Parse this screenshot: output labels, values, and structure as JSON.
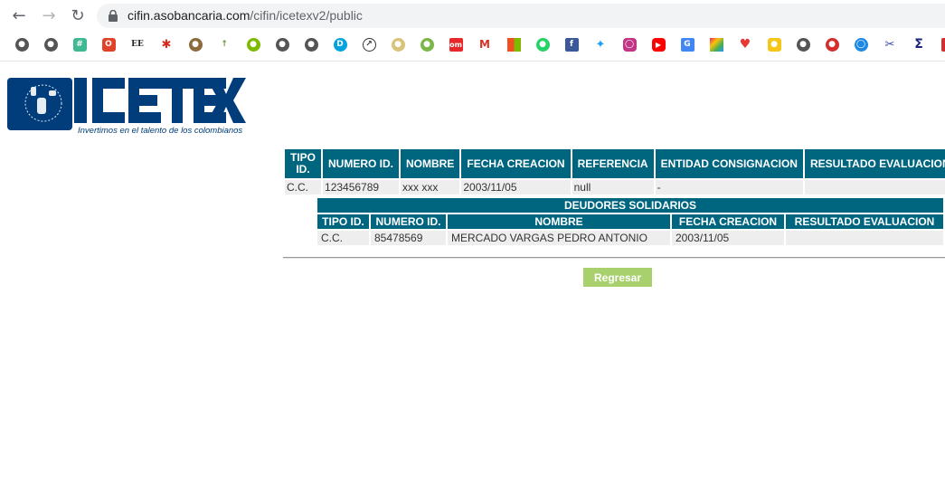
{
  "browser": {
    "url_host": "cifin.asobancaria.com",
    "url_path": "/cifin/icetexv2/public",
    "bookmark_icons": [
      "globe-icon",
      "globe-icon",
      "slack-icon",
      "power-icon",
      "ee-icon",
      "maple-leaf-icon",
      "seal-icon",
      "figure-icon",
      "bp-icon",
      "globe-icon",
      "globe-icon",
      "d-logo-icon",
      "speedometer-icon",
      "bowl-icon",
      "android-icon",
      "om-icon",
      "gmail-icon",
      "microsoft-icon",
      "whatsapp-icon",
      "facebook-icon",
      "twitter-icon",
      "instagram-icon",
      "youtube-icon",
      "translate-icon",
      "grid-icon",
      "heart-icon",
      "puzzle-icon",
      "globe-icon",
      "tomato-icon",
      "loop-icon",
      "scissors-icon",
      "sigma-icon",
      "flag-icon"
    ]
  },
  "logo": {
    "text": "ICETEX",
    "tagline": "Invertimos en el talento de los colombianos"
  },
  "main_table": {
    "headers": [
      "TIPO ID.",
      "NUMERO ID.",
      "NOMBRE",
      "FECHA CREACION",
      "REFERENCIA",
      "ENTIDAD CONSIGNACION",
      "RESULTADO EVALUACION"
    ],
    "row": [
      "C.C.",
      "123456789",
      "xxx xxx",
      "2003/11/05",
      "null",
      "-",
      ""
    ]
  },
  "deudores": {
    "title": "DEUDORES SOLIDARIOS",
    "headers": [
      "TIPO ID.",
      "NUMERO ID.",
      "NOMBRE",
      "FECHA CREACION",
      "RESULTADO EVALUACION"
    ],
    "row": [
      "C.C.",
      "85478569",
      "MERCADO VARGAS PEDRO ANTONIO",
      "2003/11/05",
      ""
    ]
  },
  "buttons": {
    "regresar": "Regresar"
  },
  "colors": {
    "header_bg": "#006680",
    "cell_bg": "#eeeeee",
    "button_bg": "#a8d16e",
    "logo_blue": "#003d7a"
  }
}
